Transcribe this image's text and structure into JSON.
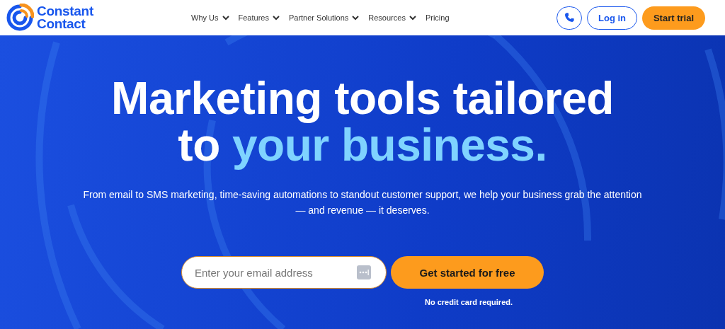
{
  "brand": {
    "lines": [
      "Constant",
      "Contact"
    ]
  },
  "nav": [
    {
      "label": "Why Us",
      "dropdown": true
    },
    {
      "label": "Features",
      "dropdown": true
    },
    {
      "label": "Partner Solutions",
      "dropdown": true
    },
    {
      "label": "Resources",
      "dropdown": true
    },
    {
      "label": "Pricing",
      "dropdown": false
    }
  ],
  "actions": {
    "login": "Log in",
    "start": "Start trial"
  },
  "hero": {
    "headline": [
      [
        {
          "text": "Marketing tools tailored",
          "highlight": false
        }
      ],
      [
        {
          "text": "to",
          "highlight": false
        },
        {
          "text": "your business.",
          "highlight": true
        }
      ]
    ],
    "subtitle": "From email to SMS marketing, time-saving automations to standout customer support, we help your business grab the attention — and revenue — it deserves.",
    "email": {
      "placeholder": "Enter your email address"
    },
    "cta": "Get started for free",
    "note": "No credit card required."
  }
}
